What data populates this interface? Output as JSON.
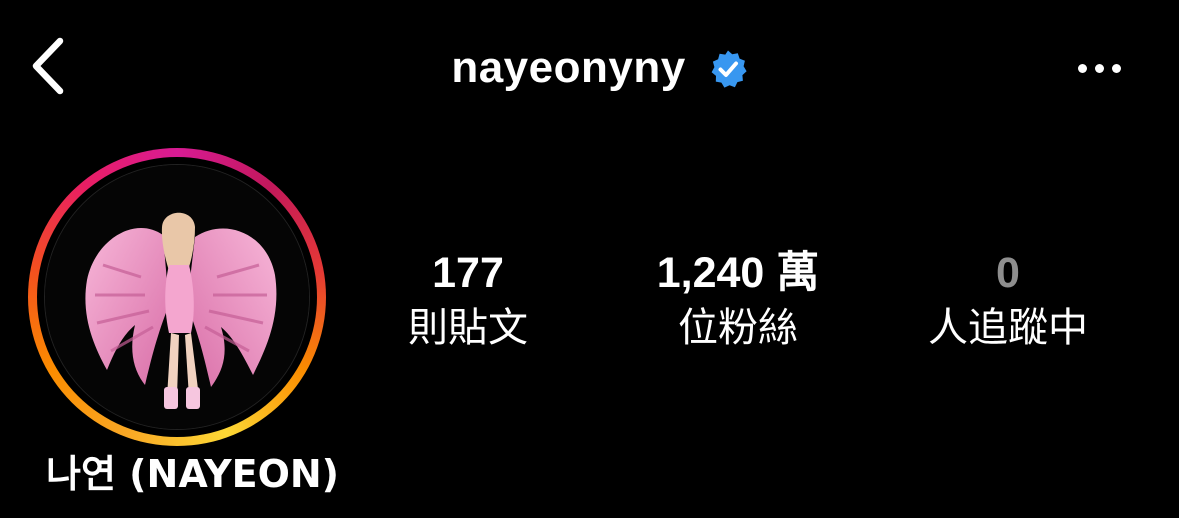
{
  "header": {
    "username": "nayeonyny",
    "verified": true,
    "icons": {
      "back": "chevron-left-icon",
      "verified": "verified-badge-icon",
      "more": "more-horizontal-icon"
    },
    "accent_color": "#3897f0"
  },
  "profile": {
    "display_name": "나연 (NAYEON)",
    "avatar": "profile-photo-woman-with-pink-angel-wings"
  },
  "stats": [
    {
      "number": "177",
      "label": "則貼文"
    },
    {
      "number": "1,240 萬",
      "label": "位粉絲"
    },
    {
      "number": "0",
      "label": "人追蹤中"
    }
  ]
}
